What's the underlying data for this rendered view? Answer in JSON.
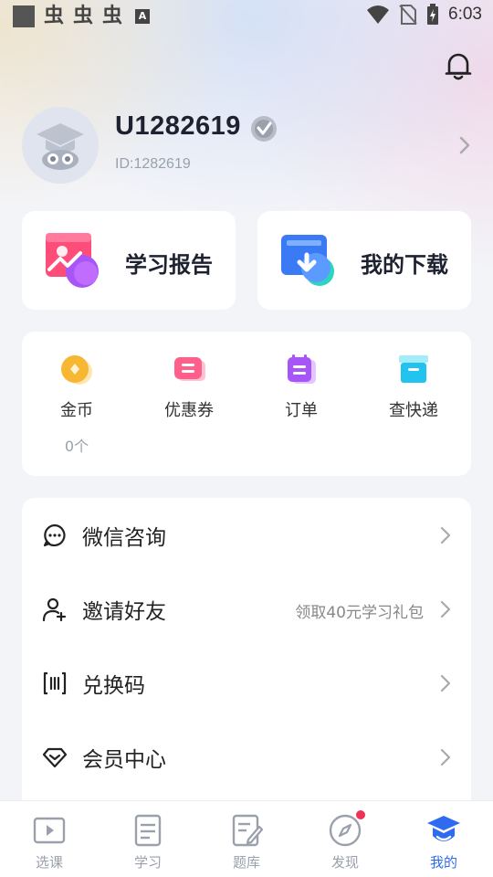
{
  "status_bar": {
    "time": "6:03",
    "left_icons": [
      "app-square-icon",
      "bug-icon",
      "bug-icon",
      "bug-icon",
      "a-badge-icon"
    ],
    "bug_glyph": "虫",
    "a_glyph": "A",
    "right_icons": [
      "wifi-icon",
      "no-sim-icon",
      "battery-charging-icon"
    ]
  },
  "profile": {
    "username": "U1282619",
    "user_id": "ID:1282619"
  },
  "big_cards": [
    {
      "label": "学习报告",
      "icon": "report-icon"
    },
    {
      "label": "我的下载",
      "icon": "download-icon"
    }
  ],
  "quick_items": [
    {
      "label": "金币",
      "sub": "0个",
      "icon": "coin-icon"
    },
    {
      "label": "优惠券",
      "sub": "",
      "icon": "coupon-icon"
    },
    {
      "label": "订单",
      "sub": "",
      "icon": "order-icon"
    },
    {
      "label": "查快递",
      "sub": "",
      "icon": "express-icon"
    }
  ],
  "menu_items": [
    {
      "label": "微信咨询",
      "extra": "",
      "icon": "chat-icon"
    },
    {
      "label": "邀请好友",
      "extra": "领取40元学习礼包",
      "icon": "add-user-icon"
    },
    {
      "label": "兑换码",
      "extra": "",
      "icon": "redeem-code-icon"
    },
    {
      "label": "会员中心",
      "extra": "",
      "icon": "diamond-icon"
    }
  ],
  "tabs": [
    {
      "label": "选课",
      "icon": "play-video-icon",
      "active": false
    },
    {
      "label": "学习",
      "icon": "notebook-icon",
      "active": false
    },
    {
      "label": "题库",
      "icon": "edit-paper-icon",
      "active": false
    },
    {
      "label": "发现",
      "icon": "compass-icon",
      "active": false,
      "badge": true
    },
    {
      "label": "我的",
      "icon": "graduation-cap-icon",
      "active": true
    }
  ],
  "colors": {
    "accent": "#2e6bf0",
    "badge_red": "#f0325a",
    "coin": "#f7b733",
    "coupon": "#ff5f8a",
    "order": "#a855f7",
    "express": "#22c3ee"
  }
}
